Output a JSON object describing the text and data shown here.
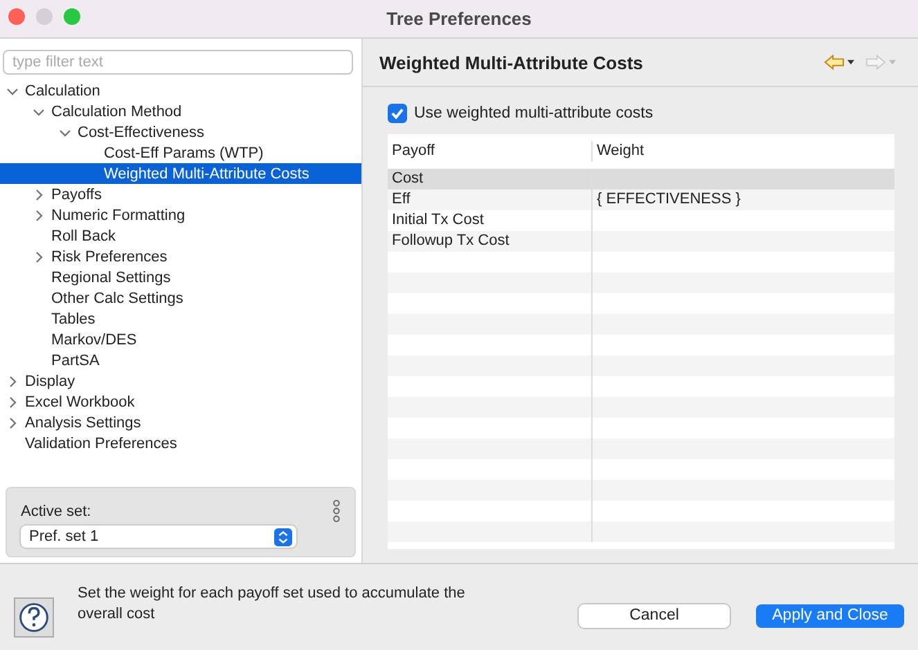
{
  "window": {
    "title": "Tree Preferences"
  },
  "filter": {
    "placeholder": "type filter text"
  },
  "tree": [
    {
      "label": "Calculation",
      "expanded": true,
      "selected": false,
      "children": [
        {
          "label": "Calculation Method",
          "expanded": true,
          "selected": false,
          "children": [
            {
              "label": "Cost-Effectiveness",
              "expanded": true,
              "selected": false,
              "children": [
                {
                  "label": "Cost-Eff Params (WTP)",
                  "selected": false
                },
                {
                  "label": "Weighted Multi-Attribute Costs",
                  "selected": true
                }
              ]
            }
          ]
        },
        {
          "label": "Payoffs",
          "expanded": false,
          "selected": false
        },
        {
          "label": "Numeric Formatting",
          "expanded": false,
          "selected": false
        },
        {
          "label": "Roll Back",
          "selected": false
        },
        {
          "label": "Risk Preferences",
          "expanded": false,
          "selected": false
        },
        {
          "label": "Regional Settings",
          "selected": false
        },
        {
          "label": "Other Calc Settings",
          "selected": false
        },
        {
          "label": "Tables",
          "selected": false
        },
        {
          "label": "Markov/DES",
          "selected": false
        },
        {
          "label": "PartSA",
          "selected": false
        }
      ]
    },
    {
      "label": "Display",
      "expanded": false,
      "selected": false
    },
    {
      "label": "Excel Workbook",
      "expanded": false,
      "selected": false
    },
    {
      "label": "Analysis Settings",
      "expanded": false,
      "selected": false
    },
    {
      "label": "Validation Preferences",
      "selected": false
    }
  ],
  "active_set": {
    "label": "Active set:",
    "value": "Pref. set 1"
  },
  "page": {
    "title": "Weighted Multi-Attribute Costs",
    "checkbox": {
      "label": "Use weighted multi-attribute costs",
      "checked": true
    },
    "table": {
      "columns": [
        "Payoff",
        "Weight"
      ],
      "rows": [
        {
          "payoff": "Cost",
          "selected": true
        },
        {
          "payoff": "Eff",
          "weight": "{ EFFECTIVENESS }",
          "selected": false
        },
        {
          "payoff": "Initial Tx Cost",
          "selected": false
        },
        {
          "payoff": "Followup Tx Cost",
          "selected": false
        }
      ]
    }
  },
  "help_text": "Set the weight for each payoff set used to accumulate the overall cost",
  "buttons": [
    {
      "label": "Cancel",
      "kind": "secondary"
    },
    {
      "label": "Apply and Close",
      "kind": "primary"
    }
  ]
}
